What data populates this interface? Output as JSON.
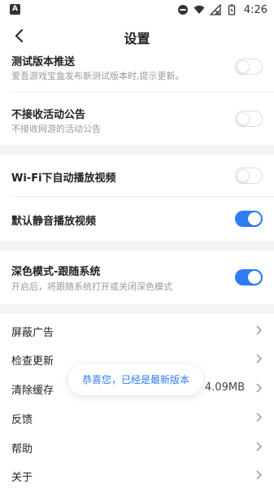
{
  "status_bar": {
    "left_badge": "A",
    "time": "4:26",
    "icons": [
      "do-not-disturb-icon",
      "wifi-icon",
      "signal-icon",
      "battery-icon"
    ]
  },
  "header": {
    "back_icon": "chevron-left-icon",
    "title": "设置"
  },
  "settings": {
    "test_version": {
      "title": "测试版本推送",
      "subtitle": "爱吾游戏宝盒发布新测试版本时,提示更新。",
      "enabled": false
    },
    "no_event_notice": {
      "title": "不接收活动公告",
      "subtitle": "不接收网游的活动公告",
      "enabled": false
    },
    "wifi_autoplay": {
      "title": "Wi-Fi下自动播放视频",
      "enabled": false
    },
    "mute_autoplay": {
      "title": "默认静音播放视频",
      "enabled": true
    },
    "dark_mode": {
      "title": "深色模式-跟随系统",
      "subtitle": "开启后，将跟随系统打开或关闭深色模式",
      "enabled": true
    },
    "block_ads": {
      "title": "屏蔽广告"
    },
    "check_update": {
      "title": "检查更新"
    },
    "clear_cache": {
      "title": "清除缓存",
      "value": "4.09MB"
    },
    "feedback": {
      "title": "反馈"
    },
    "help": {
      "title": "帮助"
    },
    "about": {
      "title": "关于"
    }
  },
  "toast": {
    "text": "恭喜您，已经是最新版本"
  },
  "colors": {
    "accent": "#2d7df0",
    "section_gap": "#f4f4f4"
  }
}
